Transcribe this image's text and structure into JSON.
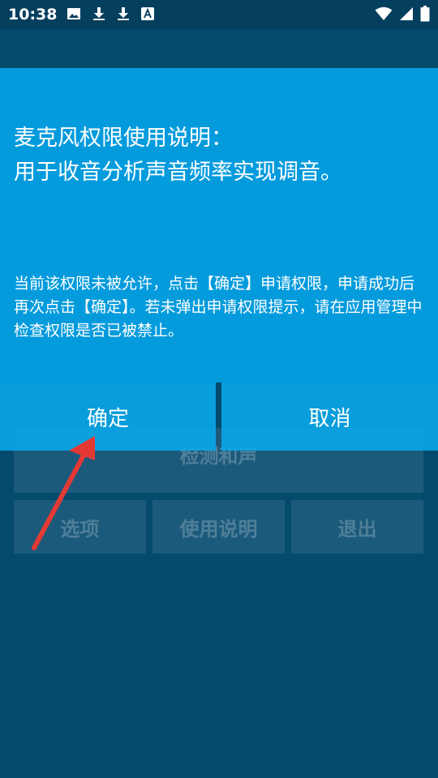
{
  "status_bar": {
    "time": "10:38",
    "left_icons": [
      "image-icon",
      "download-icon",
      "download-icon",
      "font-icon"
    ],
    "right_icons": [
      "wifi-icon",
      "cell-signal-icon",
      "battery-icon"
    ]
  },
  "app": {
    "detect_button": "检测和声",
    "options_button": "选项",
    "help_button": "使用说明",
    "exit_button": "退出"
  },
  "dialog": {
    "title": "麦克风权限使用说明：\n用于收音分析声音频率实现调音。",
    "message": "当前该权限未被允许，点击【确定】申请权限，申请成功后再次点击【确定】。若未弹出申请权限提示，请在应用管理中检查权限是否已被禁止。",
    "confirm_label": "确定",
    "cancel_label": "取消"
  },
  "colors": {
    "background": "#054b6e",
    "dialog": "#049bdd",
    "dialog_button": "#0aa8eb",
    "annotation_arrow": "#e53935"
  }
}
